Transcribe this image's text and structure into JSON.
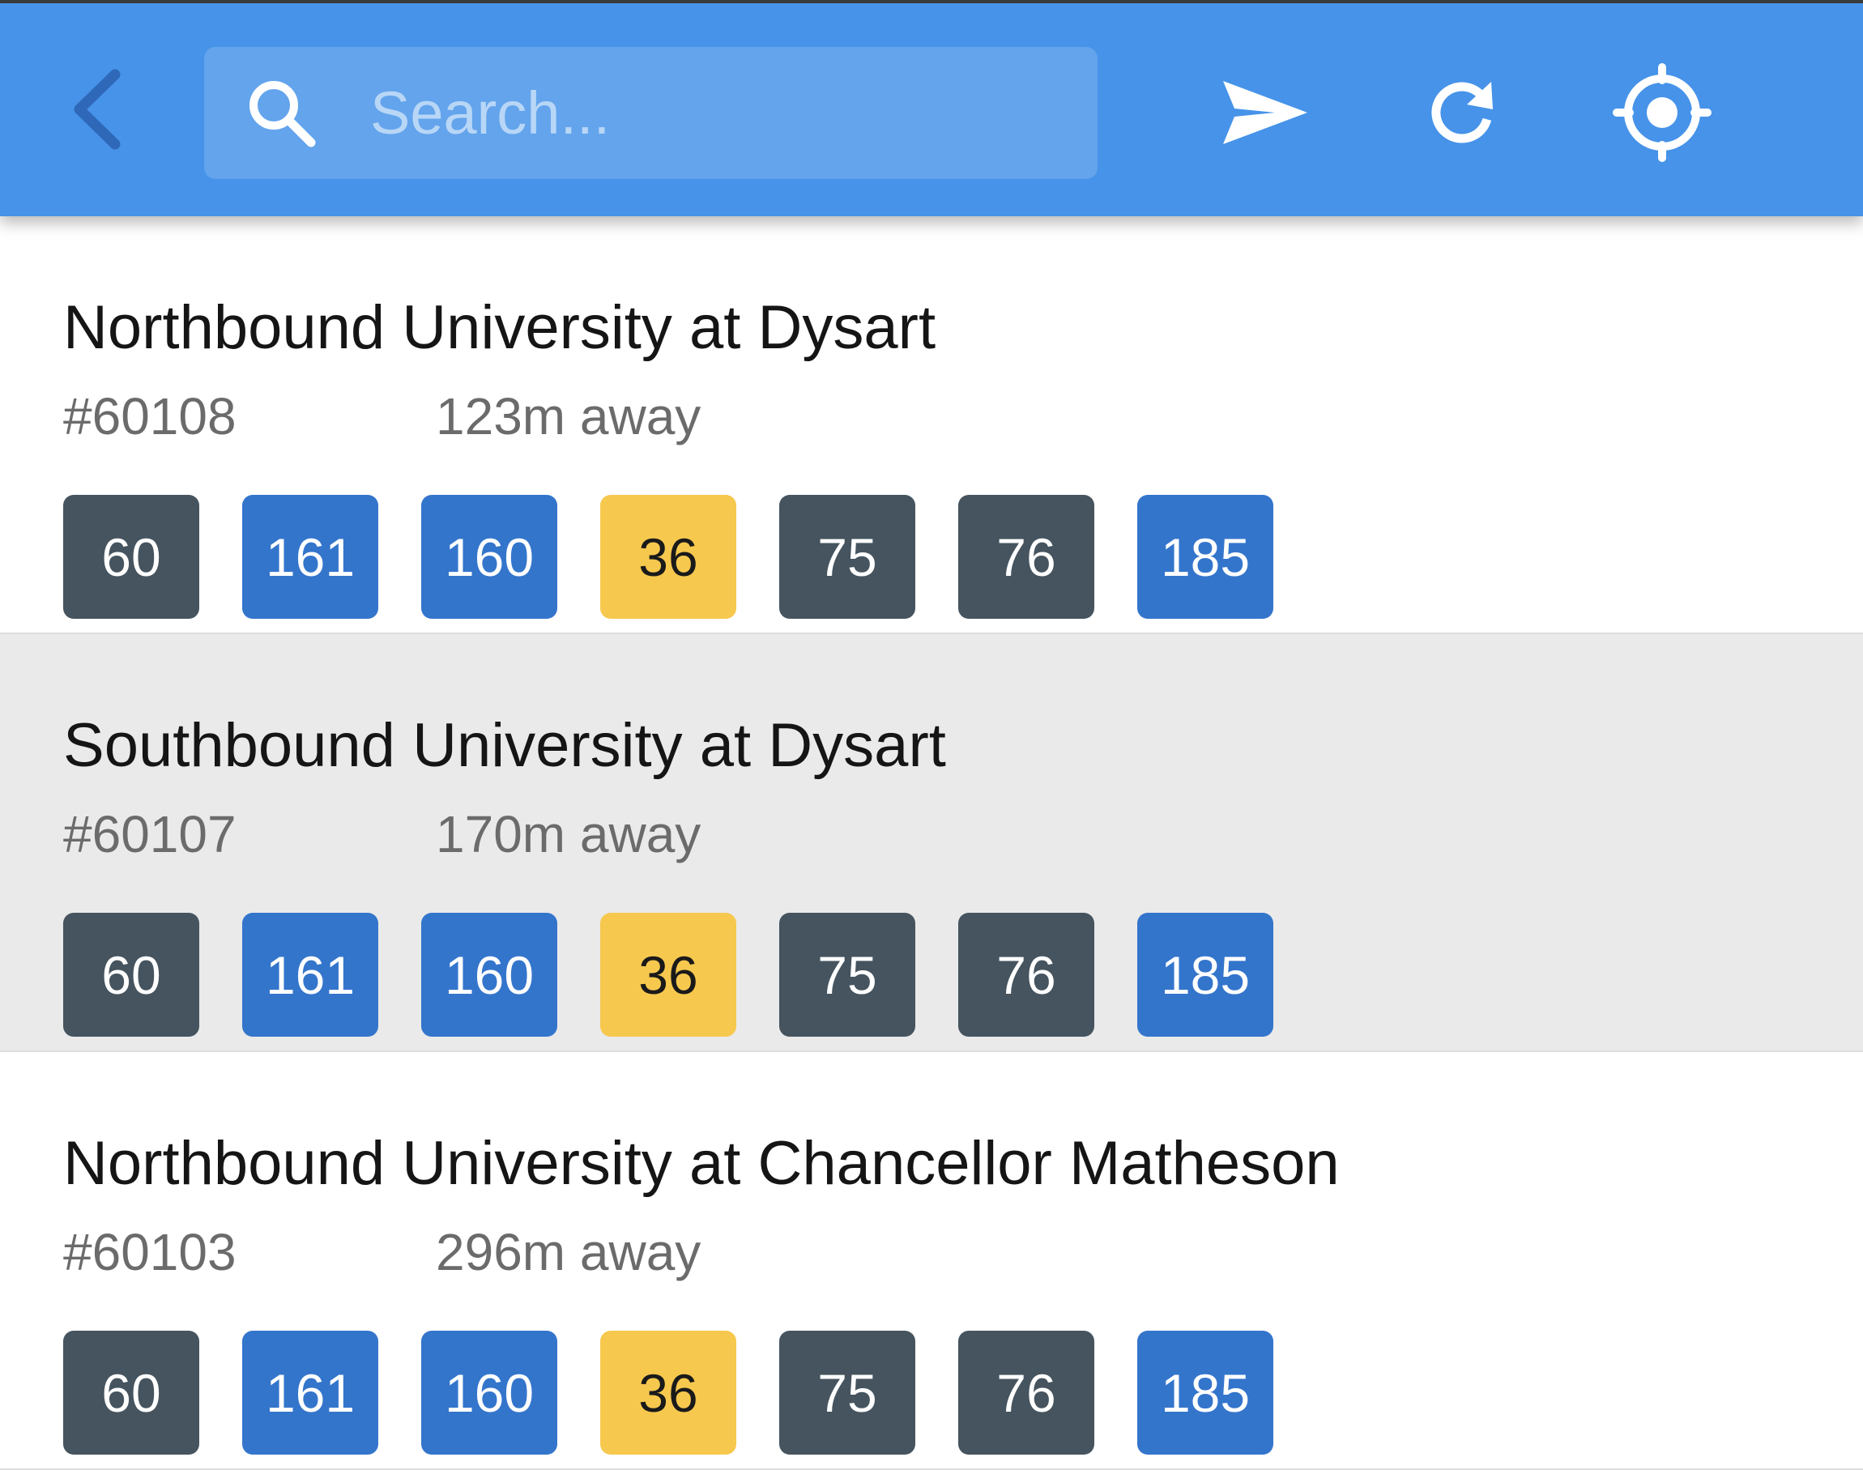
{
  "header": {
    "back_icon": "chevron-left-icon",
    "search": {
      "icon": "search-icon",
      "placeholder": "Search...",
      "value": ""
    },
    "actions": [
      {
        "name": "send",
        "icon": "send-icon"
      },
      {
        "name": "refresh",
        "icon": "refresh-icon"
      },
      {
        "name": "locate",
        "icon": "crosshair-icon"
      }
    ]
  },
  "colors": {
    "app_bar": "#4693e9",
    "route_slate": "#45545f",
    "route_blue": "#3475cc",
    "route_yellow": "#f6c84e",
    "selected_row": "#eaeaea"
  },
  "stops": [
    {
      "name": "Northbound University at Dysart",
      "id": "#60108",
      "distance": "123m away",
      "selected": false,
      "routes": [
        {
          "label": "60",
          "color": "slate"
        },
        {
          "label": "161",
          "color": "blue"
        },
        {
          "label": "160",
          "color": "blue"
        },
        {
          "label": "36",
          "color": "yellow"
        },
        {
          "label": "75",
          "color": "slate"
        },
        {
          "label": "76",
          "color": "slate"
        },
        {
          "label": "185",
          "color": "blue"
        }
      ]
    },
    {
      "name": "Southbound University at Dysart",
      "id": "#60107",
      "distance": "170m away",
      "selected": true,
      "routes": [
        {
          "label": "60",
          "color": "slate"
        },
        {
          "label": "161",
          "color": "blue"
        },
        {
          "label": "160",
          "color": "blue"
        },
        {
          "label": "36",
          "color": "yellow"
        },
        {
          "label": "75",
          "color": "slate"
        },
        {
          "label": "76",
          "color": "slate"
        },
        {
          "label": "185",
          "color": "blue"
        }
      ]
    },
    {
      "name": "Northbound University at Chancellor Matheson",
      "id": "#60103",
      "distance": "296m away",
      "selected": false,
      "routes": [
        {
          "label": "60",
          "color": "slate"
        },
        {
          "label": "161",
          "color": "blue"
        },
        {
          "label": "160",
          "color": "blue"
        },
        {
          "label": "36",
          "color": "yellow"
        },
        {
          "label": "75",
          "color": "slate"
        },
        {
          "label": "76",
          "color": "slate"
        },
        {
          "label": "185",
          "color": "blue"
        }
      ]
    }
  ]
}
